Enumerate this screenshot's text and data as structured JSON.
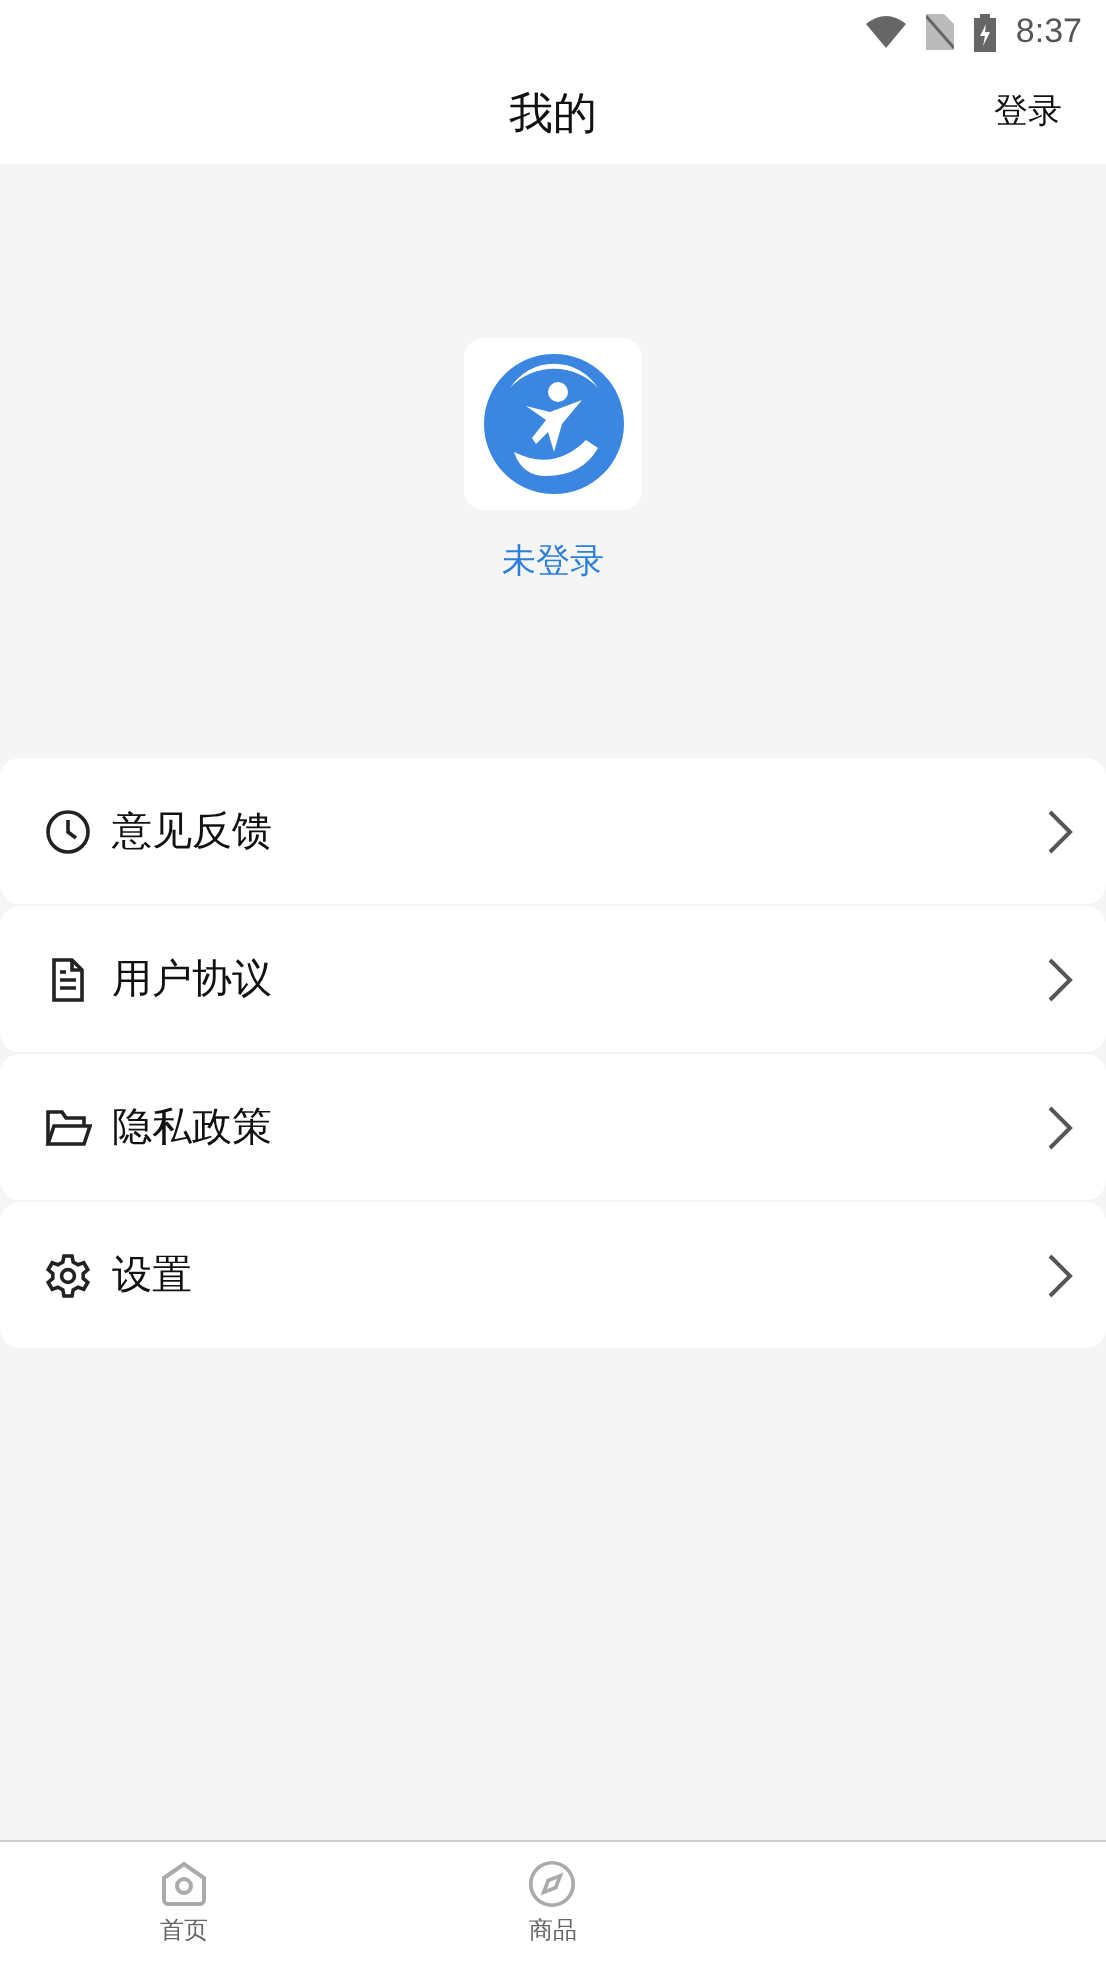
{
  "status_bar": {
    "time": "8:37"
  },
  "header": {
    "title": "我的",
    "action": "登录"
  },
  "profile": {
    "status": "未登录"
  },
  "menu": [
    {
      "kind": "clock",
      "label": "意见反馈"
    },
    {
      "kind": "document",
      "label": "用户协议"
    },
    {
      "kind": "folder",
      "label": "隐私政策"
    },
    {
      "kind": "gear",
      "label": "设置"
    }
  ],
  "tab_bar": [
    {
      "kind": "home",
      "label": "首页"
    },
    {
      "kind": "compass",
      "label": "商品"
    }
  ]
}
